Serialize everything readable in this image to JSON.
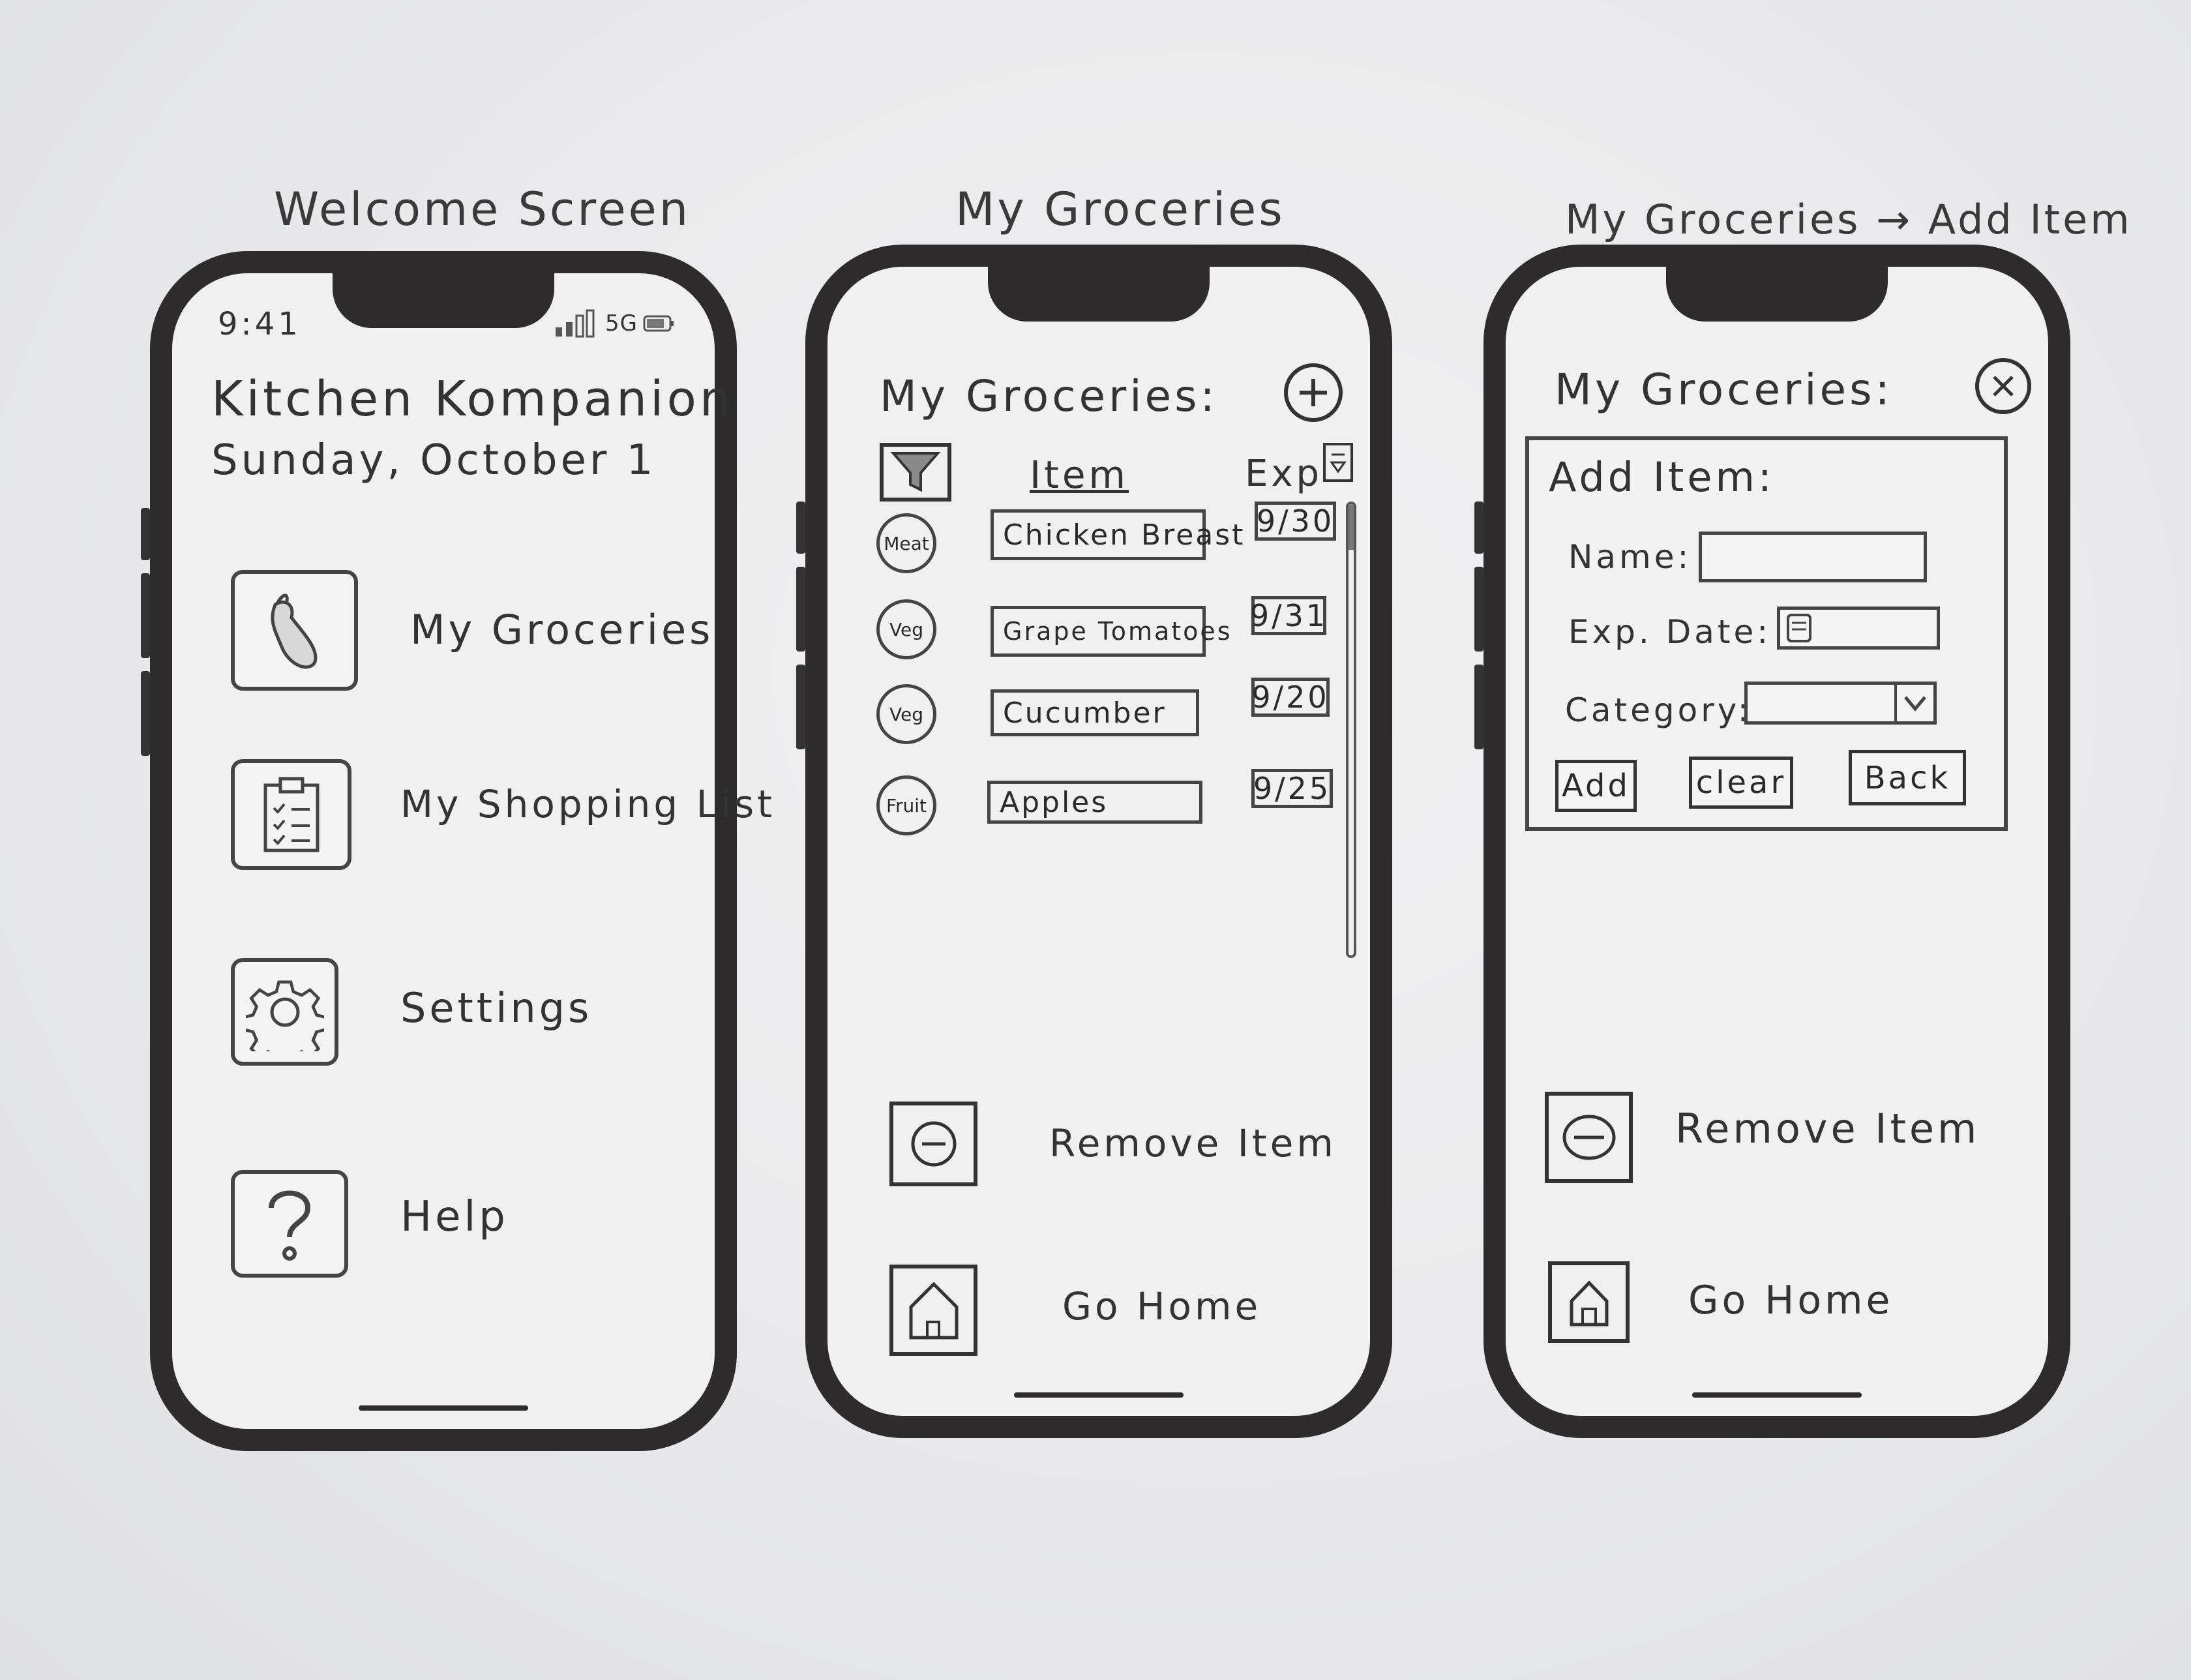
{
  "captions": {
    "welcome": "Welcome Screen",
    "groceries": "My Groceries",
    "add_item": "My Groceries → Add Item"
  },
  "welcome": {
    "time": "9:41",
    "network": "5G",
    "app_title": "Kitchen Kompanion",
    "date": "Sunday, October 1",
    "menu": [
      {
        "label": "My Groceries",
        "icon": "eggplant-icon"
      },
      {
        "label": "My Shopping List",
        "icon": "clipboard-icon"
      },
      {
        "label": "Settings",
        "icon": "gear-icon"
      },
      {
        "label": "Help",
        "icon": "question-icon"
      }
    ]
  },
  "groceries": {
    "title": "My Groceries:",
    "col_item": "Item",
    "col_exp": "Exp",
    "rows": [
      {
        "category": "Meat",
        "name": "Chicken Breast",
        "exp": "9/30"
      },
      {
        "category": "Veg",
        "name": "Grape Tomatoes",
        "exp": "9/31"
      },
      {
        "category": "Veg",
        "name": "Cucumber",
        "exp": "9/20"
      },
      {
        "category": "Fruit",
        "name": "Apples",
        "exp": "9/25"
      }
    ],
    "remove_label": "Remove Item",
    "home_label": "Go Home"
  },
  "add_item": {
    "title": "My Groceries:",
    "dialog_title": "Add Item:",
    "name_label": "Name:",
    "exp_label": "Exp. Date:",
    "category_label": "Category:",
    "buttons": {
      "add": "Add",
      "clear": "clear",
      "back": "Back"
    },
    "remove_label": "Remove Item",
    "home_label": "Go Home"
  }
}
